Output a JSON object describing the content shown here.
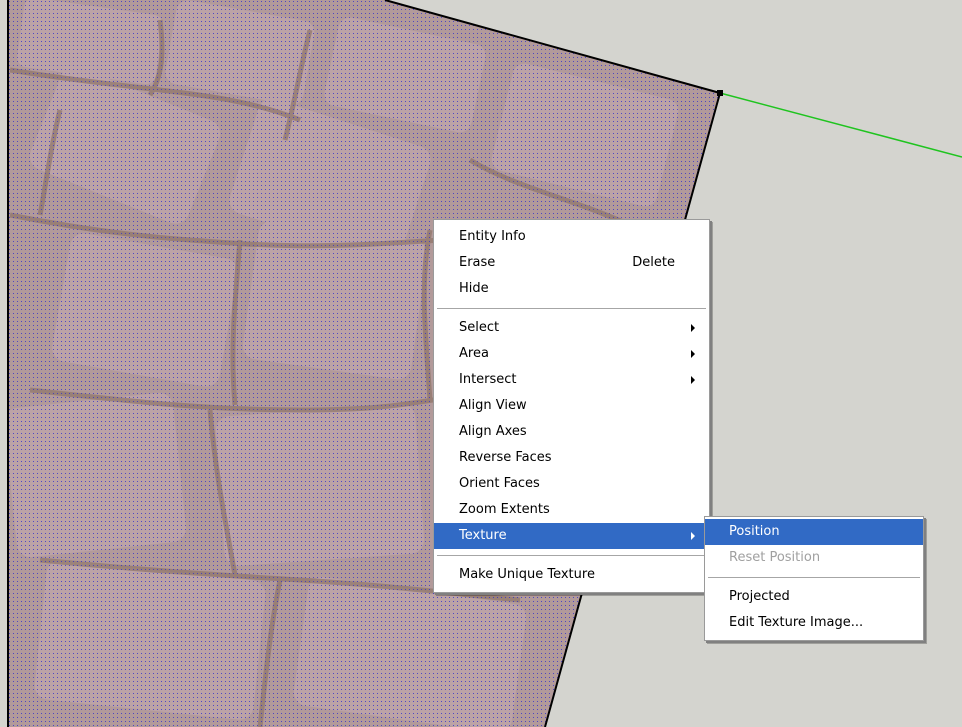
{
  "context_menu": {
    "entity_info": "Entity Info",
    "erase": "Erase",
    "erase_shortcut": "Delete",
    "hide": "Hide",
    "select": "Select",
    "area": "Area",
    "intersect": "Intersect",
    "align_view": "Align View",
    "align_axes": "Align Axes",
    "reverse_faces": "Reverse Faces",
    "orient_faces": "Orient Faces",
    "zoom_extents": "Zoom Extents",
    "texture": "Texture",
    "make_unique_texture": "Make Unique Texture"
  },
  "texture_submenu": {
    "position": "Position",
    "reset_position": "Reset Position",
    "projected": "Projected",
    "edit_texture_image": "Edit Texture Image..."
  },
  "colors": {
    "background": "#d4d4cf",
    "texture_face": "#b29a9a",
    "selection_dots": "#2a2acf",
    "axis_green": "#1fc41f",
    "menu_highlight": "#316ac5"
  }
}
